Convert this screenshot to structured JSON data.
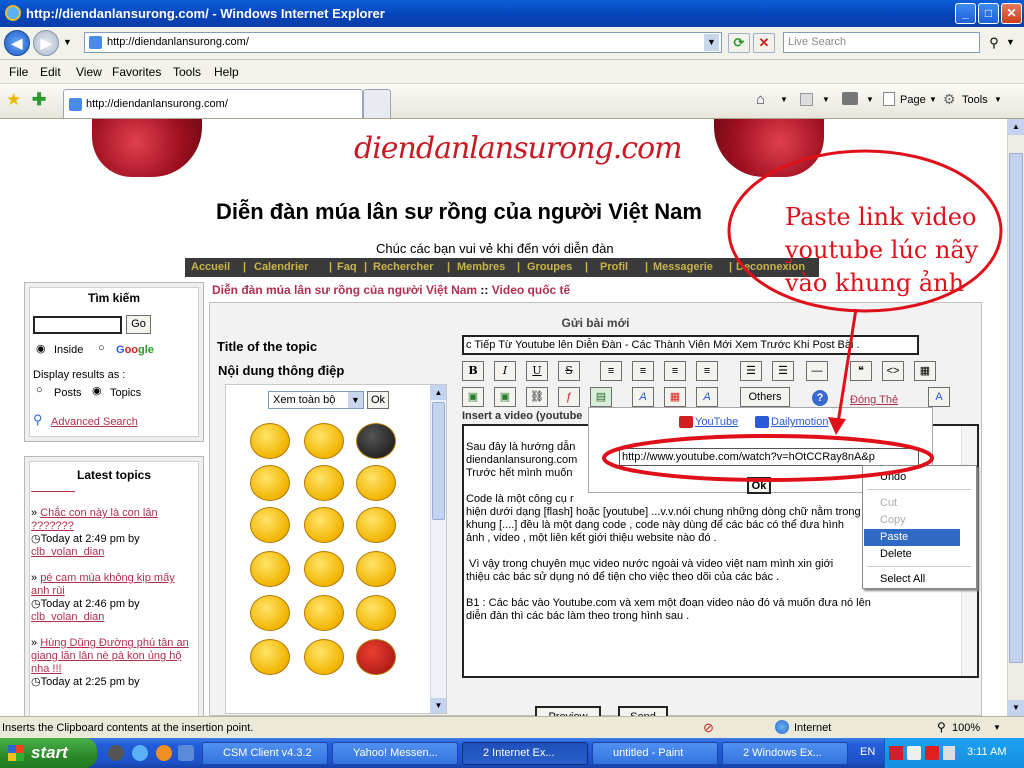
{
  "window": {
    "title": "http://diendanlansurong.com/ - Windows Internet Explorer",
    "min": "_",
    "max": "□",
    "close": "✕"
  },
  "address": {
    "url": "http://diendanlansurong.com/",
    "search_placeholder": "Live Search"
  },
  "menu": [
    "File",
    "Edit",
    "View",
    "Favorites",
    "Tools",
    "Help"
  ],
  "tab": {
    "label": "http://diendanlansurong.com/"
  },
  "cmdbar": {
    "page": "Page",
    "tools": "Tools"
  },
  "site": {
    "logo_text": "diendanlansurong.com",
    "title": "Diễn đàn múa lân sư rồng của người Việt Nam",
    "welcome": "Chúc các bạn vui vẻ khi đến với diễn đàn",
    "nav": [
      "Accueil",
      "Calendrier",
      "Faq",
      "Rechercher",
      "Membres",
      "Groupes",
      "Profil",
      "Messagerie",
      "Deconnexion"
    ],
    "breadcrumb_home": "Diễn đàn múa lân sư rồng của người Việt Nam",
    "breadcrumb_sep": "::",
    "breadcrumb_cat": "Video quốc tế"
  },
  "search": {
    "heading": "Tìm kiếm",
    "go": "Go",
    "inside": "Inside",
    "google_g": "G",
    "google_oo": "oo",
    "google_gle": "gle",
    "display_label": "Display results as :",
    "posts": "Posts",
    "topics": "Topics",
    "advanced": "Advanced Search"
  },
  "latest": {
    "heading": "Latest topics",
    "items": [
      {
        "title": "Chắc con này là con lân ???????",
        "time": "Today at 2:49 pm by",
        "author": "clb_volan_dian"
      },
      {
        "title": "pé cam múa không kịp mấy anh rùi",
        "time": "Today at 2:46 pm by",
        "author": "clb_volan_dian"
      },
      {
        "title": "Hùng Dũng Đường phú tân an giang lăn lân nè pà kon ủng hộ nha !!!",
        "time": "Today at 2:25 pm by",
        "author": ""
      }
    ]
  },
  "post": {
    "header": "Gửi bài mới",
    "title_label": "Title of the topic",
    "title_value": "c Tiếp Từ Youtube lên Diễn Đàn - Các Thành Viên Mới Xem Trước Khi Post Bài .",
    "content_label": "Nội dung thông điệp",
    "smiley_select": "Xem toàn bộ",
    "ok": "Ok",
    "others": "Others",
    "dong_the": "Đóng Thẻ",
    "insert_video": "Insert a video (youtube",
    "editor_lines": [
      "Sau đây là hướng dẫn",
      "diendanlansurong.com",
      "Trước hết mình muốn",
      "",
      "Code là một công cụ r",
      "hiện dưới dạng [flash] hoặc [youtube] ...v.v.nói chung những dòng chữ nằm trong",
      "khung [....] đều là một dạng code , code này dùng để các bác có thể đưa hình",
      "ảnh , video , một liên kết giới thiệu website nào đó .",
      "",
      " Vì vậy trong chuyên mục video nước ngoài và video việt nam mình xin giới",
      "thiệu các bác sử dụng nó để tiện cho việc theo dõi của các bác .",
      "",
      "B1 : Các bác vào Youtube.com và xem một đoạn video nào đó và muốn đưa nó lên",
      "diễn đàn thì các bác làm theo trong hình sau ."
    ],
    "preview": "Preview",
    "send": "Send"
  },
  "video_popup": {
    "youtube": "YouTube",
    "dailymotion": "Dailymotion",
    "url_value": "http://www.youtube.com/watch?v=hOtCCRay8nA&p",
    "ok": "Ok"
  },
  "context_menu": [
    "Undo",
    "Cut",
    "Copy",
    "Paste",
    "Delete",
    "Select All"
  ],
  "annotation": {
    "lines": [
      "Paste link video",
      "youtube lúc nãy",
      "vào khung ảnh"
    ],
    "color": "#e0101a"
  },
  "status": {
    "text": "Inserts the Clipboard contents at the insertion point.",
    "zone": "Internet",
    "zoom": "100%"
  },
  "taskbar": {
    "start": "start",
    "items": [
      "CSM Client v4.3.2",
      "Yahoo! Messen...",
      "2 Internet Ex...",
      "untitled - Paint",
      "2 Windows Ex..."
    ],
    "lang": "EN",
    "time": "3:11 AM"
  }
}
